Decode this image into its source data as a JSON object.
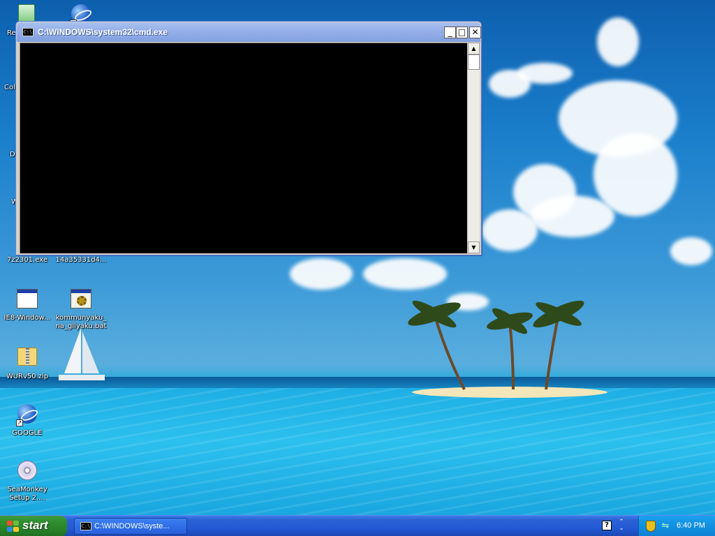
{
  "desktop": {
    "icons": [
      {
        "label": "Re",
        "icon": "recycle-bin-icon"
      },
      {
        "label": "",
        "icon": "ie-shortcut-icon"
      },
      {
        "label": "Col",
        "icon": ""
      },
      {
        "label": "D",
        "icon": ""
      },
      {
        "label": "W",
        "icon": ""
      },
      {
        "label": "7z2301.exe",
        "icon": "installer-icon"
      },
      {
        "label": "14a35331d4...",
        "icon": "folder-icon"
      },
      {
        "label": "IE8-Window...",
        "icon": "application-icon"
      },
      {
        "label": "kommunyaku_na_gilyaku.bat",
        "icon": "batch-file-icon"
      },
      {
        "label": "WURv50.zip",
        "icon": "zip-file-icon"
      },
      {
        "label": "GOOGLE",
        "icon": "internet-shortcut-icon"
      },
      {
        "label": "SeaMonkey Setup 2....",
        "icon": "cd-installer-icon"
      }
    ]
  },
  "cmd_window": {
    "title": "C:\\WINDOWS\\system32\\cmd.exe",
    "sys_icon_text": "C:\\",
    "minimize_glyph": "_",
    "maximize_glyph": "□",
    "close_glyph": "✕",
    "console_text": ""
  },
  "taskbar": {
    "start_label": "start",
    "tasks": [
      {
        "label": "C:\\WINDOWS\\syste...",
        "icon_text": "C:\\"
      }
    ],
    "help_glyph": "?",
    "chevron_glyph": "⌃⌄",
    "clock": "6:40 PM"
  },
  "colors": {
    "titlebar_inactive": "#93aee8",
    "taskbar": "#235ad4",
    "start_green": "#2f8f2f",
    "tray": "#1290e0"
  }
}
